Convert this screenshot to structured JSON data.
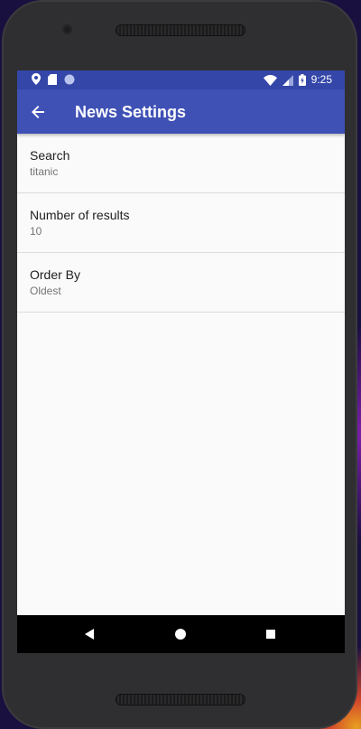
{
  "status_bar": {
    "time": "9:25",
    "left_icons": [
      "location-pin-icon",
      "sd-card-icon",
      "circle-icon"
    ],
    "right_icons": [
      "wifi-icon",
      "signal-icon",
      "battery-icon"
    ]
  },
  "app_bar": {
    "title": "News Settings",
    "back_icon": "arrow-back-icon"
  },
  "preferences": [
    {
      "title": "Search",
      "summary": "titanic"
    },
    {
      "title": "Number of results",
      "summary": "10"
    },
    {
      "title": "Order By",
      "summary": "Oldest"
    }
  ],
  "nav_bar": [
    "back-triangle-icon",
    "home-circle-icon",
    "recents-square-icon"
  ],
  "colors": {
    "status_bar": "#3446a8",
    "app_bar": "#3f51b5",
    "background": "#fafafa"
  }
}
